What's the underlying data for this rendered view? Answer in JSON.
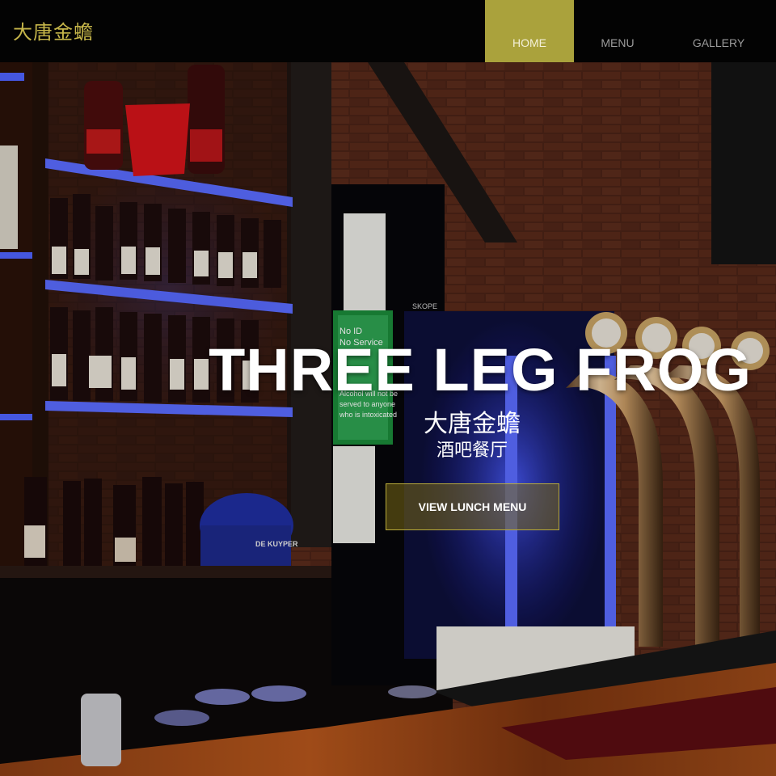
{
  "brand": {
    "name": "大唐金蟾"
  },
  "nav": {
    "items": [
      {
        "label": "HOME",
        "active": true
      },
      {
        "label": "MENU",
        "active": false
      },
      {
        "label": "GALLERY",
        "active": false
      }
    ]
  },
  "hero": {
    "title": "THREE LEG FROG",
    "subtitle_cn": "大唐金蟾",
    "subtitle_cn_2": "酒吧餐厅",
    "cta_label": "VIEW LUNCH MENU",
    "signs": {
      "no_id_line1": "No ID",
      "no_id_line2": "No Service",
      "alcohol_line1": "Alcohol will not be",
      "alcohol_line2": "served to anyone",
      "alcohol_line3": "who is intoxicated",
      "fridge_brand": "SKOPE",
      "machine_brand": "DE KUYPER"
    }
  },
  "colors": {
    "nav_bg": "#030303",
    "accent": "#aaa23c",
    "brand_text": "#c6b64a",
    "nav_text": "#9b9b9b",
    "neon_blue": "#3a49ff"
  }
}
